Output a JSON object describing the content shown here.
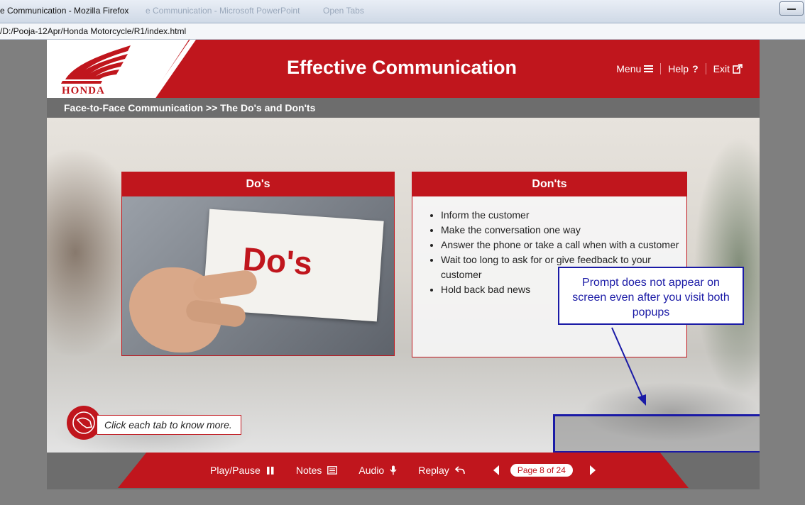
{
  "browser": {
    "window_title": "e Communication - Mozilla Firefox",
    "ghost_tabs": [
      "e Communication - Microsoft PowerPoint",
      "Open Tabs"
    ],
    "url": "/D:/Pooja-12Apr/Honda Motorcycle/R1/index.html"
  },
  "header": {
    "brand": "HONDA",
    "title": "Effective Communication",
    "nav": {
      "menu": "Menu",
      "help": "Help",
      "exit": "Exit"
    }
  },
  "breadcrumb": "Face-to-Face Communication >> The Do's and Don'ts",
  "dos": {
    "title": "Do's",
    "image_text": "Do's"
  },
  "donts": {
    "title": "Don'ts",
    "items": [
      "Inform the customer",
      "Make the conversation one way",
      "Answer the phone or take a call when with a customer",
      "Wait too long to ask for or give feedback to your customer",
      "Hold back bad news"
    ]
  },
  "instruction": "Click each tab to know more.",
  "annotation": {
    "text": "Prompt does not appear on screen even after you visit both popups",
    "color": "#1a1aa6"
  },
  "footer": {
    "play_pause": "Play/Pause",
    "notes": "Notes",
    "audio": "Audio",
    "replay": "Replay",
    "page": "Page 8 of 24"
  },
  "colors": {
    "brand_red": "#c0161d",
    "gray": "#6d6d6d"
  }
}
